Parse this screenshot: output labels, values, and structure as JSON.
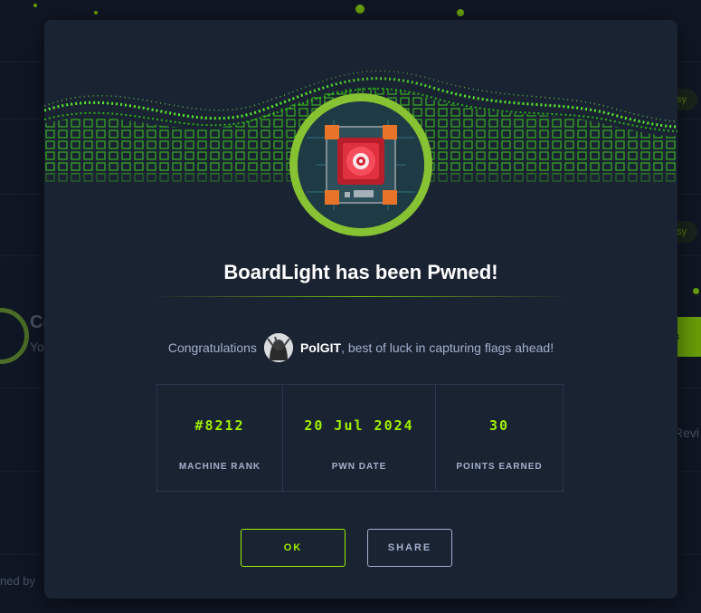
{
  "background": {
    "pill_easy_1": "asy",
    "pill_easy_2": "asy",
    "left_title": "Co",
    "left_sub": "Yo",
    "green_button": "s",
    "right_text": "Revi",
    "bottom_left_text": "ned by"
  },
  "modal": {
    "title": "BoardLight has been Pwned!",
    "congrats_prefix": "Congratulations",
    "username": "PolGIT",
    "congrats_suffix": ", best of luck in capturing flags ahead!",
    "stats": [
      {
        "value": "#8212",
        "label": "MACHINE RANK"
      },
      {
        "value": "20 Jul 2024",
        "label": "PWN DATE"
      },
      {
        "value": "30",
        "label": "POINTS EARNED"
      }
    ],
    "ok_label": "OK",
    "share_label": "SHARE"
  },
  "colors": {
    "accent": "#9fef00",
    "ring": "#86c232",
    "modal_bg": "#1a2332",
    "page_bg": "#141d2b"
  },
  "icons": {
    "machine_avatar": "circuit-board-icon",
    "user_avatar": "user-avatar-icon"
  }
}
